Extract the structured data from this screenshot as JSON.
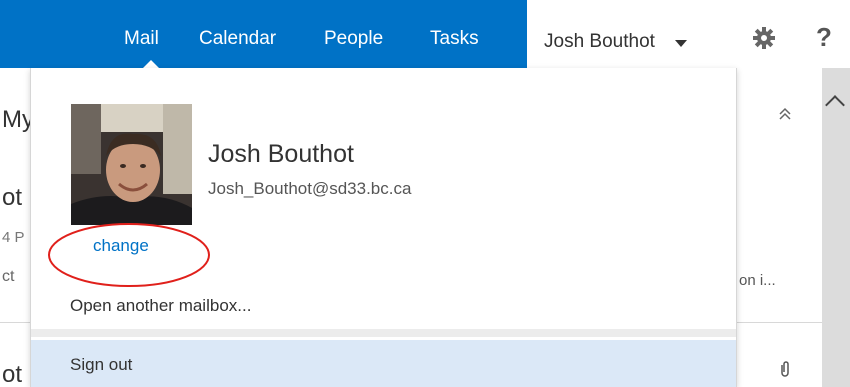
{
  "nav": {
    "items": [
      {
        "label": "Mail"
      },
      {
        "label": "Calendar"
      },
      {
        "label": "People"
      },
      {
        "label": "Tasks"
      }
    ],
    "active": "Mail",
    "user_menu_label": "Josh Bouthot",
    "accent_color": "#0072c6",
    "icons": [
      "gear-icon",
      "help-icon",
      "chevron-down-icon"
    ],
    "help_label": "?"
  },
  "background": {
    "fragments": [
      "My",
      "ot",
      "4 P",
      "ct",
      "ot"
    ],
    "preview_text": "on i...",
    "collapse_glyph": "⌃",
    "attachment_icon": "paperclip-icon"
  },
  "account_panel": {
    "display_name": "Josh Bouthot",
    "email": "Josh_Bouthot@sd33.bc.ca",
    "change_photo_label": "change",
    "open_mailbox_label": "Open another mailbox...",
    "sign_out_label": "Sign out",
    "highlight_color": "#dbe8f7"
  }
}
